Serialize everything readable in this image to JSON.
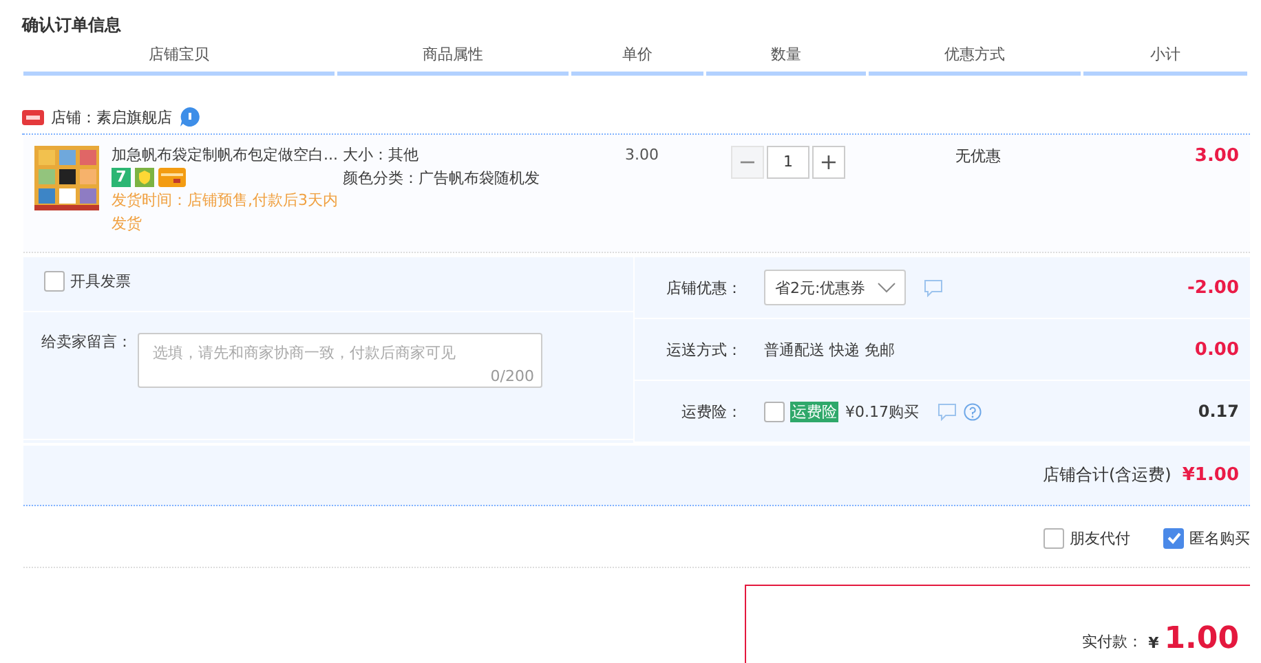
{
  "title": "确认订单信息",
  "columns": [
    "店铺宝贝",
    "商品属性",
    "单价",
    "数量",
    "优惠方式",
    "小计"
  ],
  "shop": {
    "label": "店铺：",
    "name": "素启旗舰店"
  },
  "item": {
    "title": "加急帆布袋定制帆布包定做空白...",
    "badge": "7",
    "delivery": "发货时间：店铺预售,付款后3天内发货",
    "attrs": [
      "大小：其他",
      "颜色分类：广告帆布袋随机发"
    ],
    "price": "3.00",
    "minus": "−",
    "quantity": "1",
    "plus": "+",
    "minus_disabled": true,
    "discount": "无优惠",
    "subtotal": "3.00"
  },
  "invoice": {
    "label": "开具发票",
    "checked": false
  },
  "message": {
    "label": "给卖家留言：",
    "placeholder": "选填，请先和商家协商一致，付款后商家可见",
    "counter": "0/200"
  },
  "options": [
    {
      "kind": "select",
      "label": "店铺优惠：",
      "value": "省2元:优惠券",
      "amount": "-2.00",
      "red": true
    },
    {
      "kind": "text",
      "label": "运送方式：",
      "value": "普通配送 快递 免邮",
      "amount": "0.00",
      "red": true
    },
    {
      "kind": "insurance",
      "label": "运费险：",
      "checked": false,
      "tag": "运费险",
      "value": "¥0.17购买",
      "amount": "0.17",
      "red": false
    }
  ],
  "total": {
    "label": "店铺合计(含运费)",
    "amount": "¥1.00"
  },
  "extras": [
    {
      "label": "朋友代付",
      "checked": false
    },
    {
      "label": "匿名购买",
      "checked": true
    }
  ],
  "pay": {
    "label": "实付款：",
    "currency": "¥",
    "amount": "1.00"
  }
}
